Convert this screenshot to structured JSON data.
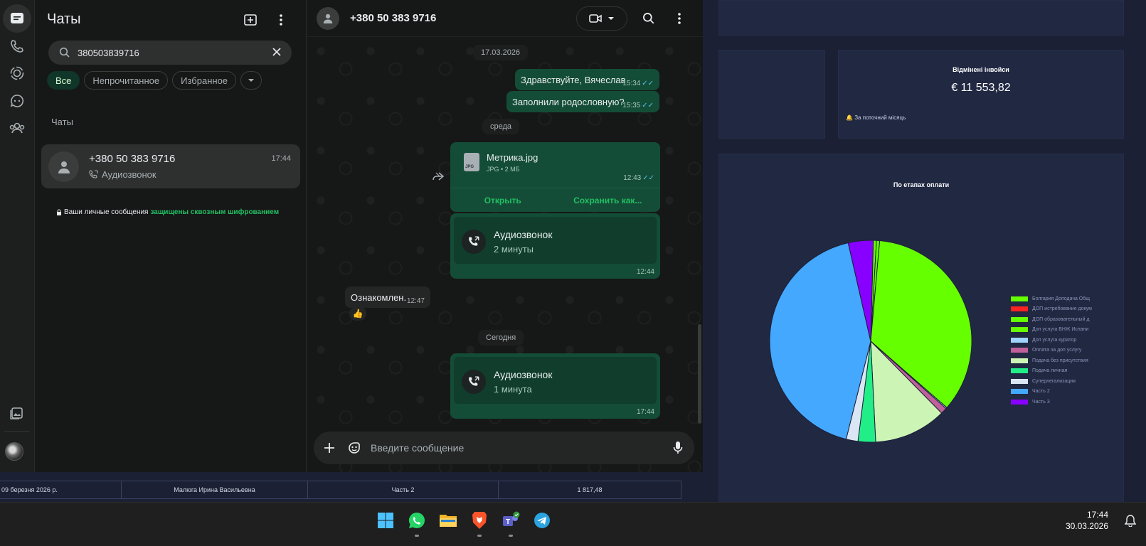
{
  "dashboard": {
    "kpi_title": "Відмінені інвойси",
    "kpi_value": "€ 11 553,82",
    "kpi_note": "За поточний місяць",
    "chart_data": {
      "type": "pie",
      "title": "По етапах оплати",
      "legend_position": "right",
      "categories": [
        "Болгария Доподача Общ",
        "ДОП истребование докум",
        "ДОП образовательный д",
        "Доп услуга ВНЖ Испани",
        "Доп услуга куратор",
        "Оплата за доп услугу",
        "Подача без присутствия",
        "Подача личная",
        "Суперлегализация",
        "Часть 2",
        "Часть 3"
      ],
      "colors": [
        "#66ff00",
        "#ff2222",
        "#66ff00",
        "#66ff00",
        "#9fd4ff",
        "#c0609a",
        "#ccf5b5",
        "#22ee88",
        "#dbe6f5",
        "#45a8ff",
        "#8800ff"
      ],
      "values": [
        0.5,
        0.0,
        0.5,
        35.0,
        0.2,
        1.0,
        11.6,
        2.8,
        1.9,
        42.5,
        4.0
      ]
    },
    "table_row": [
      "09 березня 2026 р.",
      "Малюга Ирина Васильевна",
      "Часть 2",
      "1 817,48"
    ]
  },
  "sidebar": {
    "title": "Чаты",
    "search_value": "380503839716",
    "filters": [
      "Все",
      "Непрочитанное",
      "Избранное"
    ],
    "section_label": "Чаты",
    "chat": {
      "name": "+380 50 383 9716",
      "time": "17:44",
      "preview": "Аудиозвонок"
    },
    "e2e_text": "Ваши личные сообщения",
    "e2e_link": "защищены сквозным шифрованием"
  },
  "conversation": {
    "contact": "+380 50 383 9716",
    "date1": "17.03.2026",
    "msg1": {
      "text": "Здравствуйте, Вячеслав",
      "time": "15:34"
    },
    "msg2": {
      "text": "Заполнили родословную?",
      "time": "15:35"
    },
    "date2": "среда",
    "file": {
      "name": "Метрика.jpg",
      "ext": "JPG",
      "meta": "JPG • 2 МБ",
      "time": "12:43",
      "open": "Открыть",
      "save": "Сохранить как..."
    },
    "call1": {
      "title": "Аудиозвонок",
      "duration": "2 минуты",
      "time": "12:44"
    },
    "incoming": {
      "text": "Ознакомлен.",
      "time": "12:47",
      "reaction": "👍"
    },
    "date3": "Сегодня",
    "call2": {
      "title": "Аудиозвонок",
      "duration": "1 минута",
      "time": "17:44"
    },
    "composer_placeholder": "Введите сообщение"
  },
  "taskbar": {
    "time": "17:44",
    "date": "30.03.2026"
  }
}
